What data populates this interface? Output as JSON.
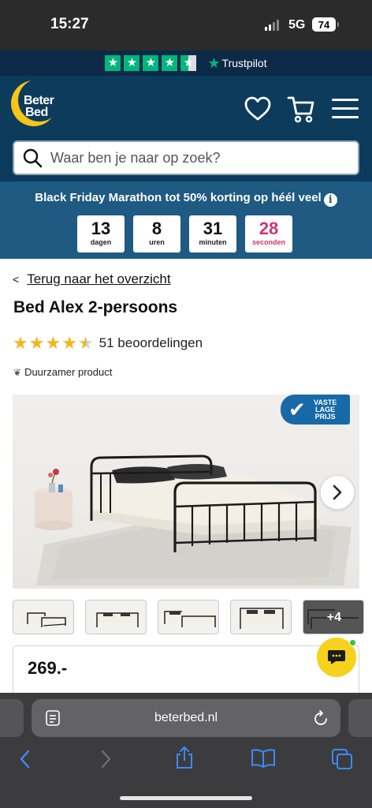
{
  "status_bar": {
    "time": "15:27",
    "network": "5G",
    "battery": "74"
  },
  "trust_bar": {
    "rating_stars": 4.5,
    "brand": "Trustpilot"
  },
  "header": {
    "logo_line1": "Beter",
    "logo_line2": "Bed",
    "search_placeholder": "Waar ben je naar op zoek?"
  },
  "promo": {
    "title": "Black Friday Marathon tot 50% korting op héél veel",
    "countdown": [
      {
        "value": "13",
        "unit": "dagen"
      },
      {
        "value": "8",
        "unit": "uren"
      },
      {
        "value": "31",
        "unit": "minuten"
      },
      {
        "value": "28",
        "unit": "seconden"
      }
    ]
  },
  "product": {
    "back_link": "Terug naar het overzicht",
    "title": "Bed Alex 2-persoons",
    "rating": 4.5,
    "reviews": "51 beoordelingen",
    "sustainability": "Duurzamer product",
    "badge_line1": "VASTE",
    "badge_line2": "LAGE",
    "badge_line3": "PRIJS",
    "more_images": "+4",
    "price": "269.-"
  },
  "browser": {
    "url": "beterbed.nl"
  },
  "colors": {
    "navy": "#0d3b5c",
    "promo_blue": "#1e5a82",
    "trustpilot_green": "#00b67a",
    "star_yellow": "#f2b71c",
    "seconds_pink": "#d6336c",
    "chat_yellow": "#f6d21d"
  }
}
